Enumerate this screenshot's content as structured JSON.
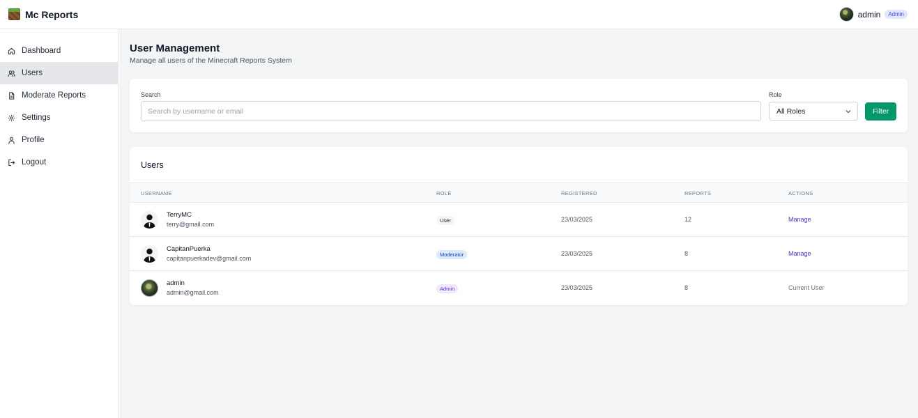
{
  "header": {
    "brand_title": "Mc Reports",
    "user_name": "admin",
    "user_badge": "Admin"
  },
  "sidebar": {
    "items": [
      {
        "label": "Dashboard",
        "icon": "home-icon",
        "active": false
      },
      {
        "label": "Users",
        "icon": "users-icon",
        "active": true
      },
      {
        "label": "Moderate Reports",
        "icon": "document-icon",
        "active": false
      },
      {
        "label": "Settings",
        "icon": "gear-icon",
        "active": false
      },
      {
        "label": "Profile",
        "icon": "user-icon",
        "active": false
      },
      {
        "label": "Logout",
        "icon": "logout-icon",
        "active": false
      }
    ]
  },
  "main": {
    "title": "User Management",
    "subtitle": "Manage all users of the Minecraft Reports System"
  },
  "filters": {
    "search_label": "Search",
    "search_placeholder": "Search by username or email",
    "search_value": "",
    "role_label": "Role",
    "role_value": "All Roles",
    "filter_button": "Filter"
  },
  "users_table": {
    "title": "Users",
    "columns": {
      "username": "USERNAME",
      "role": "ROLE",
      "registered": "REGISTERED",
      "reports": "REPORTS",
      "actions": "ACTIONS"
    },
    "rows": [
      {
        "username": "TerryMC",
        "email": "terry@gmail.com",
        "role": "User",
        "registered": "23/03/2025",
        "reports": "12",
        "action": "Manage"
      },
      {
        "username": "CapitanPuerka",
        "email": "capitanpuerkadev@gmail.com",
        "role": "Moderator",
        "registered": "23/03/2025",
        "reports": "8",
        "action": "Manage"
      },
      {
        "username": "admin",
        "email": "admin@gmail.com",
        "role": "Admin",
        "registered": "23/03/2025",
        "reports": "8",
        "action": "Current User"
      }
    ]
  },
  "colors": {
    "accent_green": "#059669",
    "link_indigo": "#4338ca",
    "active_nav": "#e5e7eb",
    "main_bg": "#f3f4f6"
  }
}
